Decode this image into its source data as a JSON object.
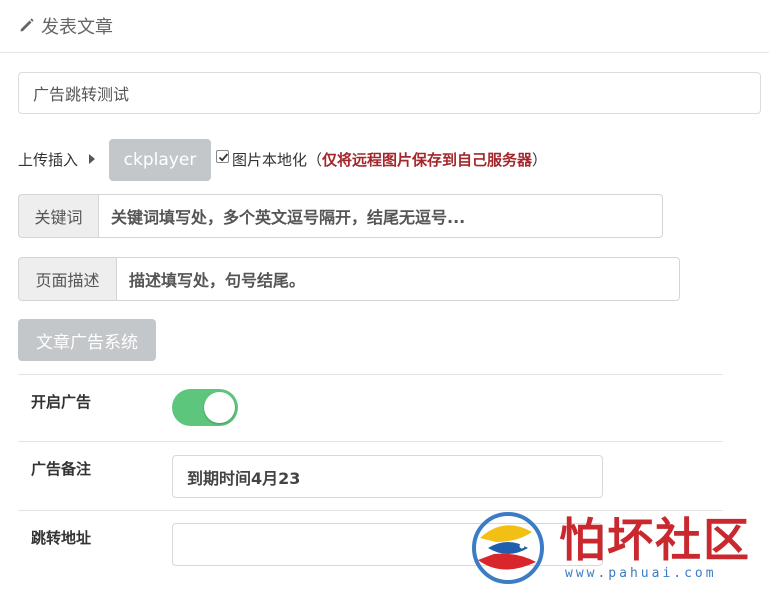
{
  "header": {
    "title": "发表文章",
    "icon": "pencil-icon"
  },
  "article": {
    "title_value": "广告跳转测试"
  },
  "upload": {
    "label": "上传插入",
    "player_button": "ckplayer",
    "localize_checked": true,
    "localize_label": "图片本地化",
    "localize_note_open": "（",
    "localize_note": "仅将远程图片保存到自己服务器",
    "localize_note_close": "）"
  },
  "keywords": {
    "addon": "关键词",
    "value": "关键词填写处，多个英文逗号隔开，结尾无逗号..."
  },
  "description": {
    "addon": "页面描述",
    "value": "描述填写处，句号结尾。"
  },
  "ad_system": {
    "button": "文章广告系统",
    "enable_label": "开启广告",
    "enabled": true,
    "note_label": "广告备注",
    "note_value": "到期时间4月23",
    "url_label": "跳转地址",
    "url_value": ""
  },
  "watermark": {
    "brand": "怕坏社区",
    "url": "www.pahuai.com"
  },
  "colors": {
    "toggle_on": "#5cc67d",
    "note_red": "#a3282d",
    "button_gray": "#c4c7ca",
    "brand_red": "#c9282f",
    "brand_blue": "#3b7cc4"
  }
}
